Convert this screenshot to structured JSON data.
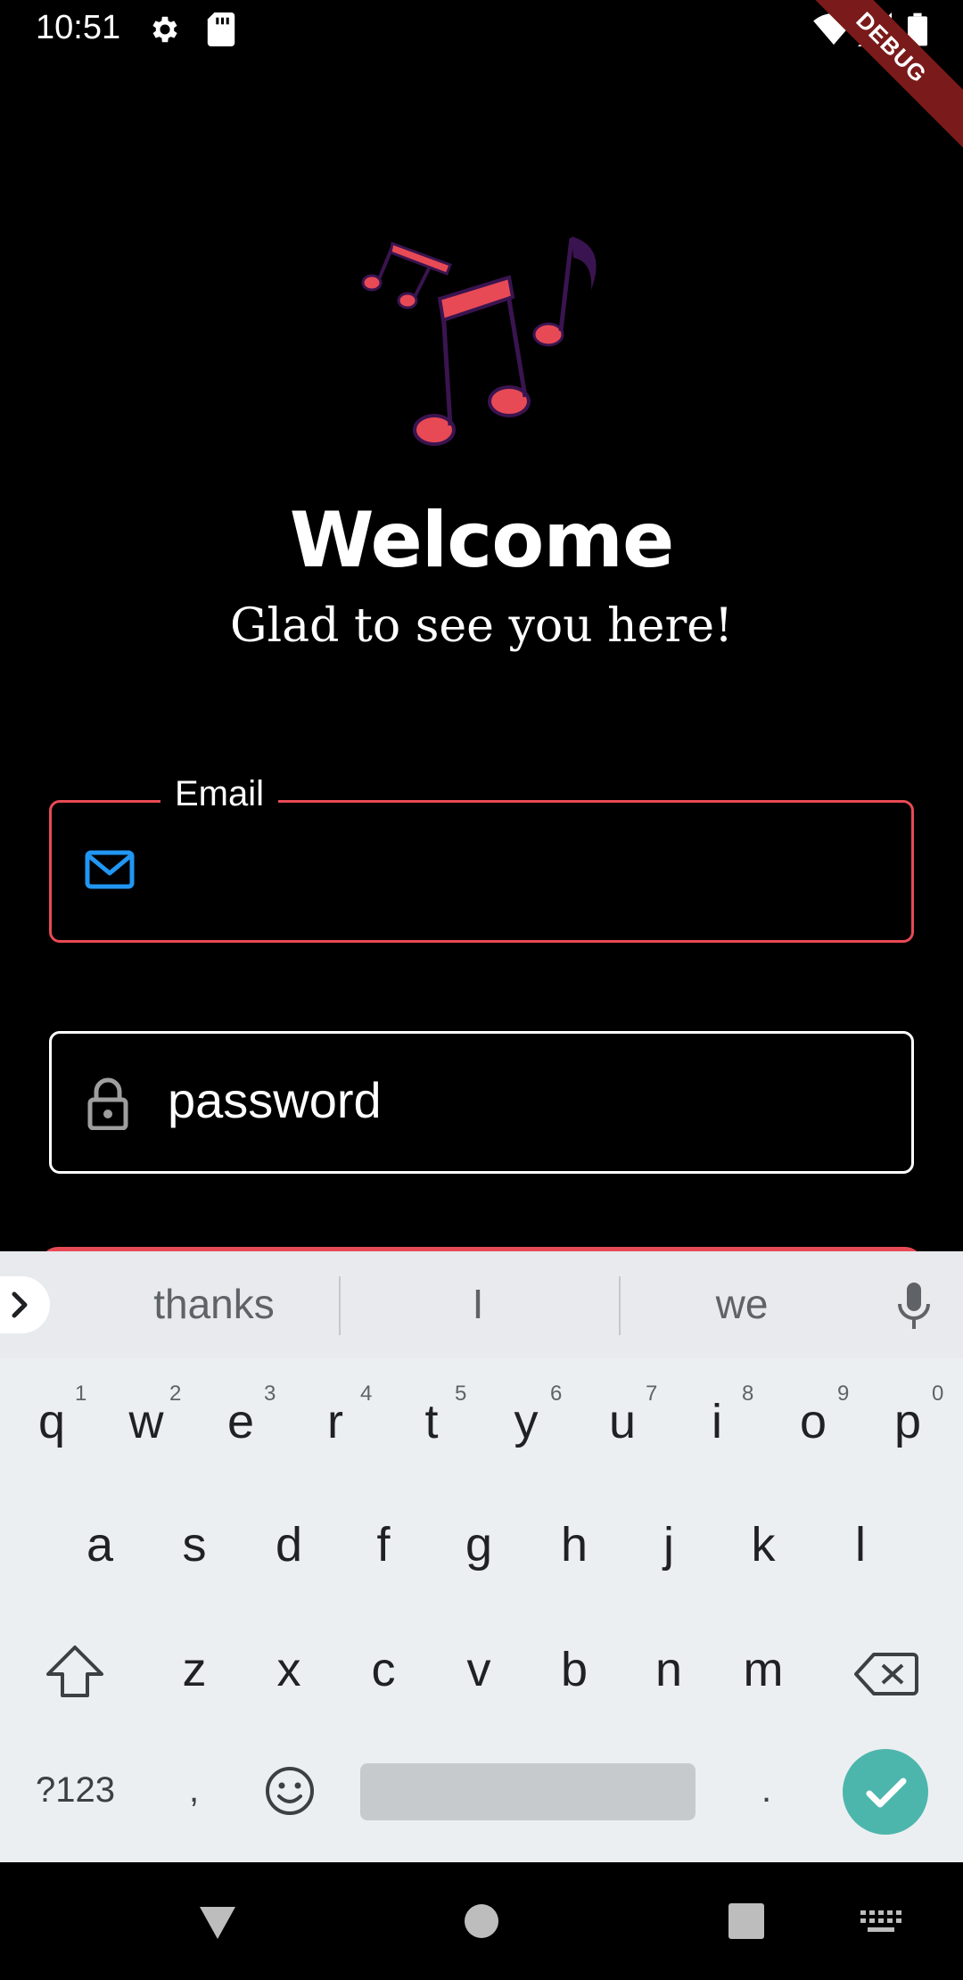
{
  "status_bar": {
    "time": "10:51",
    "debug_banner": "DEBUG"
  },
  "welcome": {
    "title": "Welcome",
    "subtitle": "Glad to see you here!"
  },
  "form": {
    "email_label": "Email",
    "email_value": "",
    "password_placeholder": "password"
  },
  "colors": {
    "accent": "#e84a55",
    "note_purple": "#3a1450",
    "email_icon": "#2196f3",
    "keyboard_bg": "#eceff1",
    "done_key": "#4db6ac"
  },
  "keyboard": {
    "suggestions": [
      "thanks",
      "I",
      "we"
    ],
    "row1": [
      "q",
      "w",
      "e",
      "r",
      "t",
      "y",
      "u",
      "i",
      "o",
      "p"
    ],
    "row1_hints": [
      "1",
      "2",
      "3",
      "4",
      "5",
      "6",
      "7",
      "8",
      "9",
      "0"
    ],
    "row2": [
      "a",
      "s",
      "d",
      "f",
      "g",
      "h",
      "j",
      "k",
      "l"
    ],
    "row3": [
      "z",
      "x",
      "c",
      "v",
      "b",
      "n",
      "m"
    ],
    "symbols_key": "?123",
    "comma_key": ",",
    "period_key": "."
  }
}
